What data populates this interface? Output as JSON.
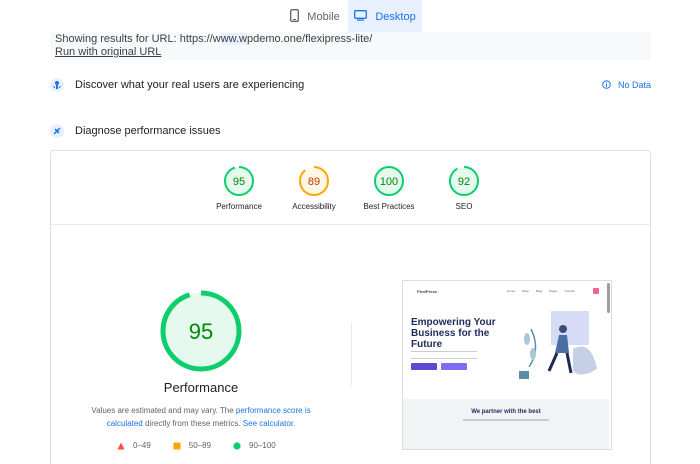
{
  "tabs": [
    {
      "label": "Mobile",
      "icon": "phone-icon",
      "active": false
    },
    {
      "label": "Desktop",
      "icon": "monitor-icon",
      "active": true
    }
  ],
  "url_box": {
    "prefix": "Showing results for URL: https://w",
    "highlight": "ww.w",
    "suffix": "pdemo.one/flexipress-lite/",
    "original_link": "Run with original URL"
  },
  "field_data": {
    "title": "Discover what your real users are experiencing",
    "status": "No Data"
  },
  "diagnose": {
    "title": "Diagnose performance issues"
  },
  "scores": [
    {
      "label": "Performance",
      "value": "95",
      "color": "#0cce6b",
      "text_color": "#008800",
      "fraction": 0.95
    },
    {
      "label": "Accessibility",
      "value": "89",
      "color": "#ffa400",
      "text_color": "#c33300",
      "fraction": 0.89
    },
    {
      "label": "Best Practices",
      "value": "100",
      "color": "#0cce6b",
      "text_color": "#008800",
      "fraction": 1.0
    },
    {
      "label": "SEO",
      "value": "92",
      "color": "#0cce6b",
      "text_color": "#008800",
      "fraction": 0.92
    }
  ],
  "main_score": {
    "value": "95",
    "label": "Performance",
    "fraction": 0.95,
    "color": "#0cce6b"
  },
  "note": {
    "text1": "Values are estimated and may vary. The ",
    "link1": "performance score is calculated",
    "text2": " directly from these metrics. ",
    "link2": "See calculator."
  },
  "legend": [
    {
      "range": "0–49",
      "shape": "triangle",
      "color": "#ff4e42"
    },
    {
      "range": "50–89",
      "shape": "square",
      "color": "#ffa400"
    },
    {
      "range": "90–100",
      "shape": "circle",
      "color": "#0cce6b"
    }
  ],
  "preview": {
    "logo": "FlexiPress",
    "menu": [
      "Home",
      "Shop",
      "Blog",
      "Pages",
      "Contact"
    ],
    "headline": "Empowering Your Business for the Future",
    "partner": "We partner with the best"
  },
  "colors": {
    "accent": "#1a73e8",
    "active_tab_bg": "#e8f0fe"
  }
}
